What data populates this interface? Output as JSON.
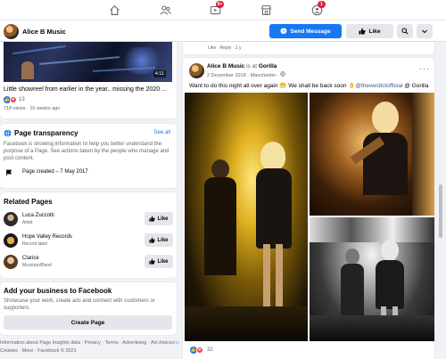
{
  "nav": {
    "items": [
      {
        "icon": "home-icon"
      },
      {
        "icon": "friends-icon"
      },
      {
        "icon": "watch-icon",
        "badge": "9+"
      },
      {
        "icon": "marketplace-icon"
      },
      {
        "icon": "groups-icon",
        "badge": "1"
      }
    ]
  },
  "page_header": {
    "name": "Alice B Music",
    "send_message": "Send Message",
    "like": "Like"
  },
  "video": {
    "duration": "4:11",
    "title": "Little showreel from earlier in the year.. missing the 2020 ...",
    "reaction_count": "13",
    "meta": "718 views · 10 weeks ago"
  },
  "transparency": {
    "title": "Page transparency",
    "see_all": "See all",
    "description": "Facebook is showing information to help you better understand the purpose of a Page. See actions taken by the people who manage and post content.",
    "created": "Page created – 7 May 2017"
  },
  "related": {
    "title": "Related Pages",
    "like_label": "Like",
    "items": [
      {
        "name": "Luca Zuccotti",
        "category": "Artist"
      },
      {
        "name": "Hope Valley Records",
        "category": "Record label"
      },
      {
        "name": "Clarice",
        "category": "Musician/Band"
      }
    ]
  },
  "business": {
    "title": "Add your business to Facebook",
    "description": "Showcase your work, create ads and connect with customers or supporters.",
    "button": "Create Page"
  },
  "footer": {
    "line1": "Information about Page Insights data · Privacy · Terms · Advertising · Ad choices ▷",
    "line2": "Cookies · More · Facebook © 2021"
  },
  "prev_comment": {
    "actions": "Like · Reply · 1 y"
  },
  "post": {
    "author": "Alice B Music",
    "is_at": "is at",
    "place": "Gorilla",
    "meta": "2 December 2019 · Manchester · ",
    "text_pre": "Want to do this night all over again ",
    "text_mid": " We shall be back soon ",
    "text_tag": "@theverdictofficial",
    "text_at": " @ Gorilla",
    "reaction_count": "32"
  },
  "colors": {
    "accent": "#1877f2",
    "badge": "#e41e3f",
    "background": "#f0f2f5"
  }
}
